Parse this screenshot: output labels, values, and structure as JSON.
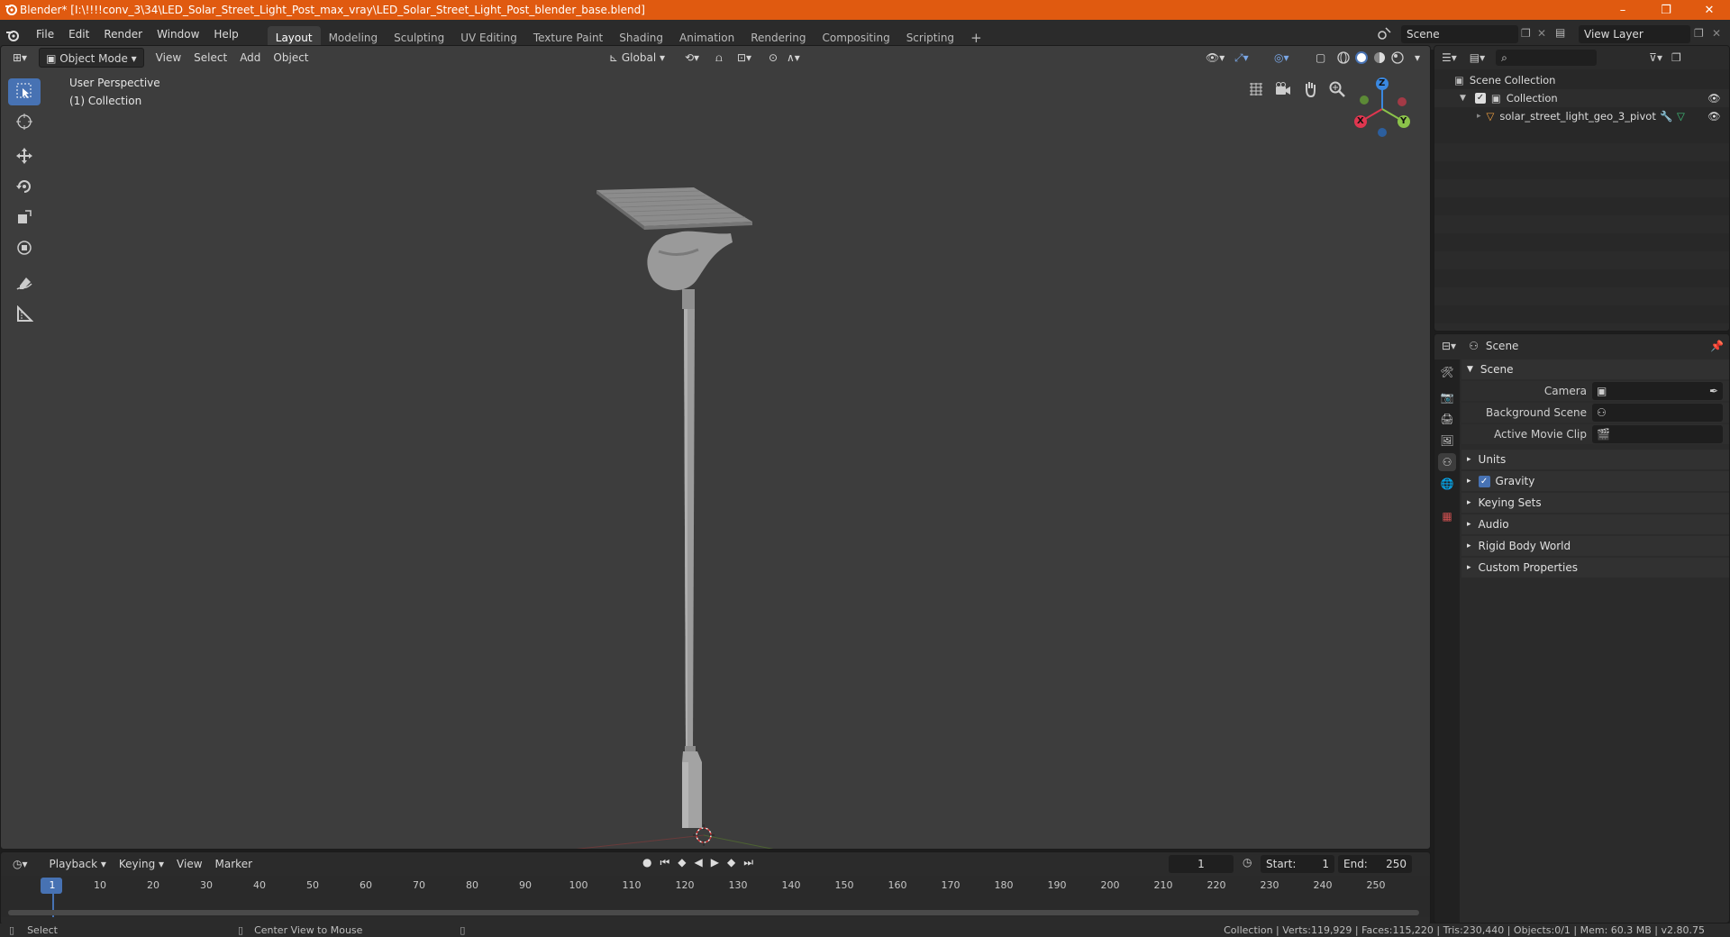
{
  "window": {
    "title": "Blender* [I:\\!!!!conv_3\\34\\LED_Solar_Street_Light_Post_max_vray\\LED_Solar_Street_Light_Post_blender_base.blend]",
    "minimize": "–",
    "restore": "❐",
    "close": "✕"
  },
  "menu": [
    "File",
    "Edit",
    "Render",
    "Window",
    "Help"
  ],
  "workspaces": [
    "Layout",
    "Modeling",
    "Sculpting",
    "UV Editing",
    "Texture Paint",
    "Shading",
    "Animation",
    "Rendering",
    "Compositing",
    "Scripting"
  ],
  "add_workspace": "+",
  "scene_name": "Scene",
  "view_layer": "View Layer",
  "viewport": {
    "mode": "Object Mode",
    "menus": [
      "View",
      "Select",
      "Add",
      "Object"
    ],
    "orientation": "Global",
    "overlay_line1": "User Perspective",
    "overlay_line2": "(1) Collection"
  },
  "gizmo": {
    "x": "X",
    "y": "Y",
    "z": "Z"
  },
  "outliner": {
    "search_placeholder": "",
    "scene_collection": "Scene Collection",
    "collection": "Collection",
    "object": "solar_street_light_geo_3_pivot"
  },
  "properties": {
    "header": "Scene",
    "panel_scene": "Scene",
    "camera_label": "Camera",
    "bg_scene_label": "Background Scene",
    "movie_clip_label": "Active Movie Clip",
    "panels": [
      "Units",
      "Gravity",
      "Keying Sets",
      "Audio",
      "Rigid Body World",
      "Custom Properties"
    ]
  },
  "timeline": {
    "menus": [
      "Playback",
      "Keying",
      "View",
      "Marker"
    ],
    "current_frame": "1",
    "start_label": "Start:",
    "start": "1",
    "end_label": "End:",
    "end": "250",
    "ticks": [
      "1",
      "10",
      "20",
      "30",
      "40",
      "50",
      "60",
      "70",
      "80",
      "90",
      "100",
      "110",
      "120",
      "130",
      "140",
      "150",
      "160",
      "170",
      "180",
      "190",
      "200",
      "210",
      "220",
      "230",
      "240",
      "250"
    ]
  },
  "status": {
    "select": "Select",
    "center": "Center View to Mouse",
    "stats": "Collection | Verts:119,929 | Faces:115,220 | Tris:230,440 | Objects:0/1 | Mem: 60.3 MB | v2.80.75"
  },
  "colors": {
    "titlebar": "#e05a10",
    "accent": "#4772b3",
    "viewport_bg": "#3d3d3d",
    "axis_x": "#e0364f",
    "axis_y": "#8bc34a",
    "axis_z": "#3a88e0"
  }
}
